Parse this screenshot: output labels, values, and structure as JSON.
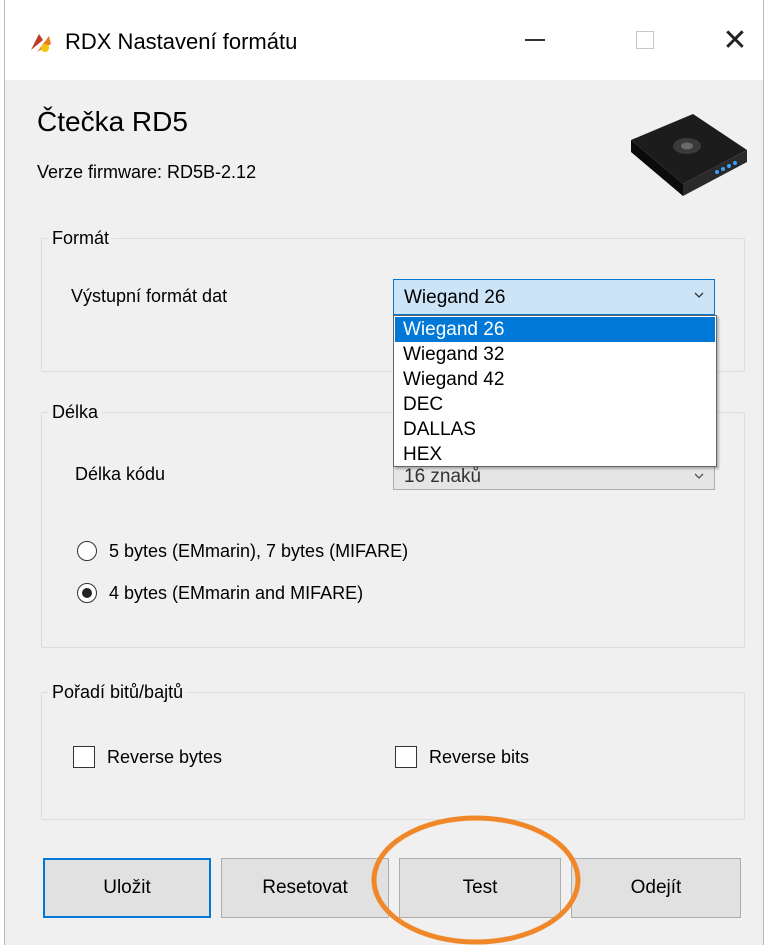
{
  "window": {
    "title": "RDX Nastavení formátu",
    "controls": [
      "minimize-icon",
      "maximize-icon",
      "close-icon"
    ],
    "close_glyph": "✕"
  },
  "header": {
    "heading": "Čtečka RD5",
    "firmware": "Verze firmware: RD5B-2.12"
  },
  "format_group": {
    "legend": "Formát",
    "output_label": "Výstupní formát dat",
    "selected": "Wiegand 26",
    "options": [
      "Wiegand 26",
      "Wiegand 32",
      "Wiegand 42",
      "DEC",
      "DALLAS",
      "HEX"
    ],
    "selected_index": 0
  },
  "length_group": {
    "legend": "Délka",
    "code_length_label": "Délka kódu",
    "code_length_value": "16 znaků",
    "radio_1": "5 bytes (EMmarin), 7 bytes (MIFARE)",
    "radio_2": "4 bytes (EMmarin and MIFARE)",
    "radio_selected": 2
  },
  "order_group": {
    "legend": "Pořadí bitů/bajtů",
    "reverse_bytes": "Reverse bytes",
    "reverse_bits": "Reverse bits",
    "reverse_bytes_checked": false,
    "reverse_bits_checked": false
  },
  "buttons": {
    "save": "Uložit",
    "reset": "Resetovat",
    "test": "Test",
    "exit": "Odejít"
  },
  "colors": {
    "accent": "#0078d7",
    "annotation": "#f0882a",
    "window_bg": "#f0f0f0"
  }
}
